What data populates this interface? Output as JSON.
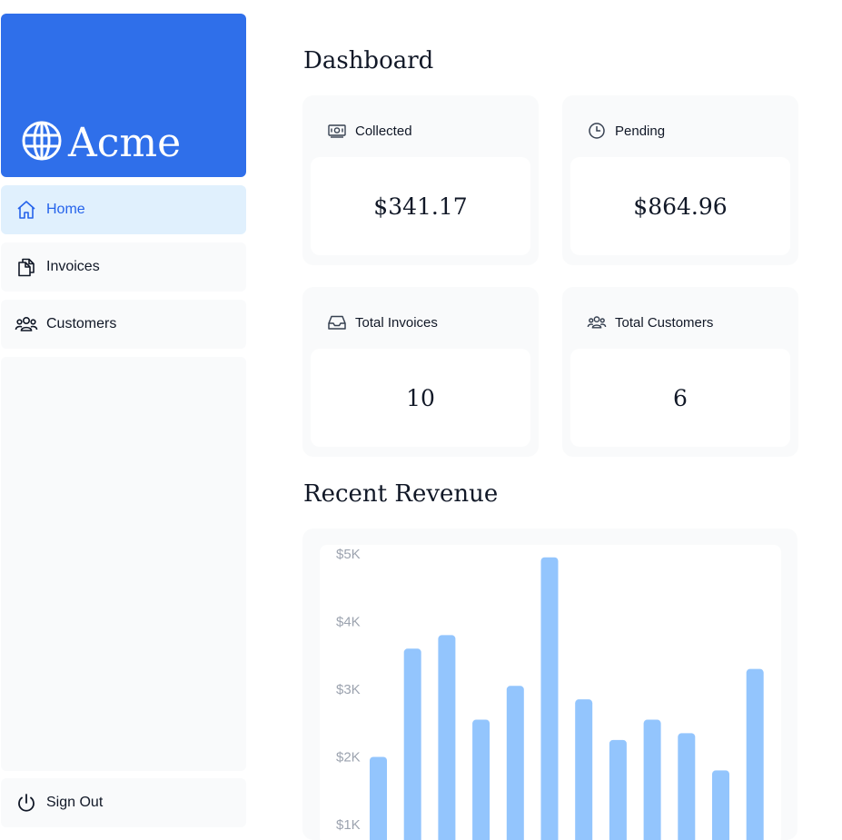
{
  "brand": {
    "name": "Acme",
    "color": "#2f6fea",
    "icon": "globe-icon"
  },
  "sidebar": {
    "items": [
      {
        "label": "Home",
        "icon": "home-icon",
        "active": true
      },
      {
        "label": "Invoices",
        "icon": "documents-icon",
        "active": false
      },
      {
        "label": "Customers",
        "icon": "users-icon",
        "active": false
      }
    ],
    "signout": {
      "label": "Sign Out",
      "icon": "power-icon"
    }
  },
  "main": {
    "title": "Dashboard",
    "cards": [
      {
        "label": "Collected",
        "value": "$341.17",
        "icon": "banknote-icon"
      },
      {
        "label": "Pending",
        "value": "$864.96",
        "icon": "clock-icon"
      },
      {
        "label": "Total Invoices",
        "value": "10",
        "icon": "inbox-icon"
      },
      {
        "label": "Total Customers",
        "value": "6",
        "icon": "users-icon"
      }
    ],
    "revenue_title": "Recent Revenue"
  },
  "chart_data": {
    "type": "bar",
    "title": "Recent Revenue",
    "xlabel": "",
    "ylabel": "",
    "y_ticks": [
      "$5K",
      "$4K",
      "$3K",
      "$2K",
      "$1K"
    ],
    "ylim": [
      1000,
      5000
    ],
    "values": [
      2000,
      3600,
      3800,
      2550,
      3050,
      4950,
      2850,
      2250,
      2550,
      2350,
      1800,
      3300
    ],
    "bar_color": "#93c5fd",
    "grid": false
  }
}
